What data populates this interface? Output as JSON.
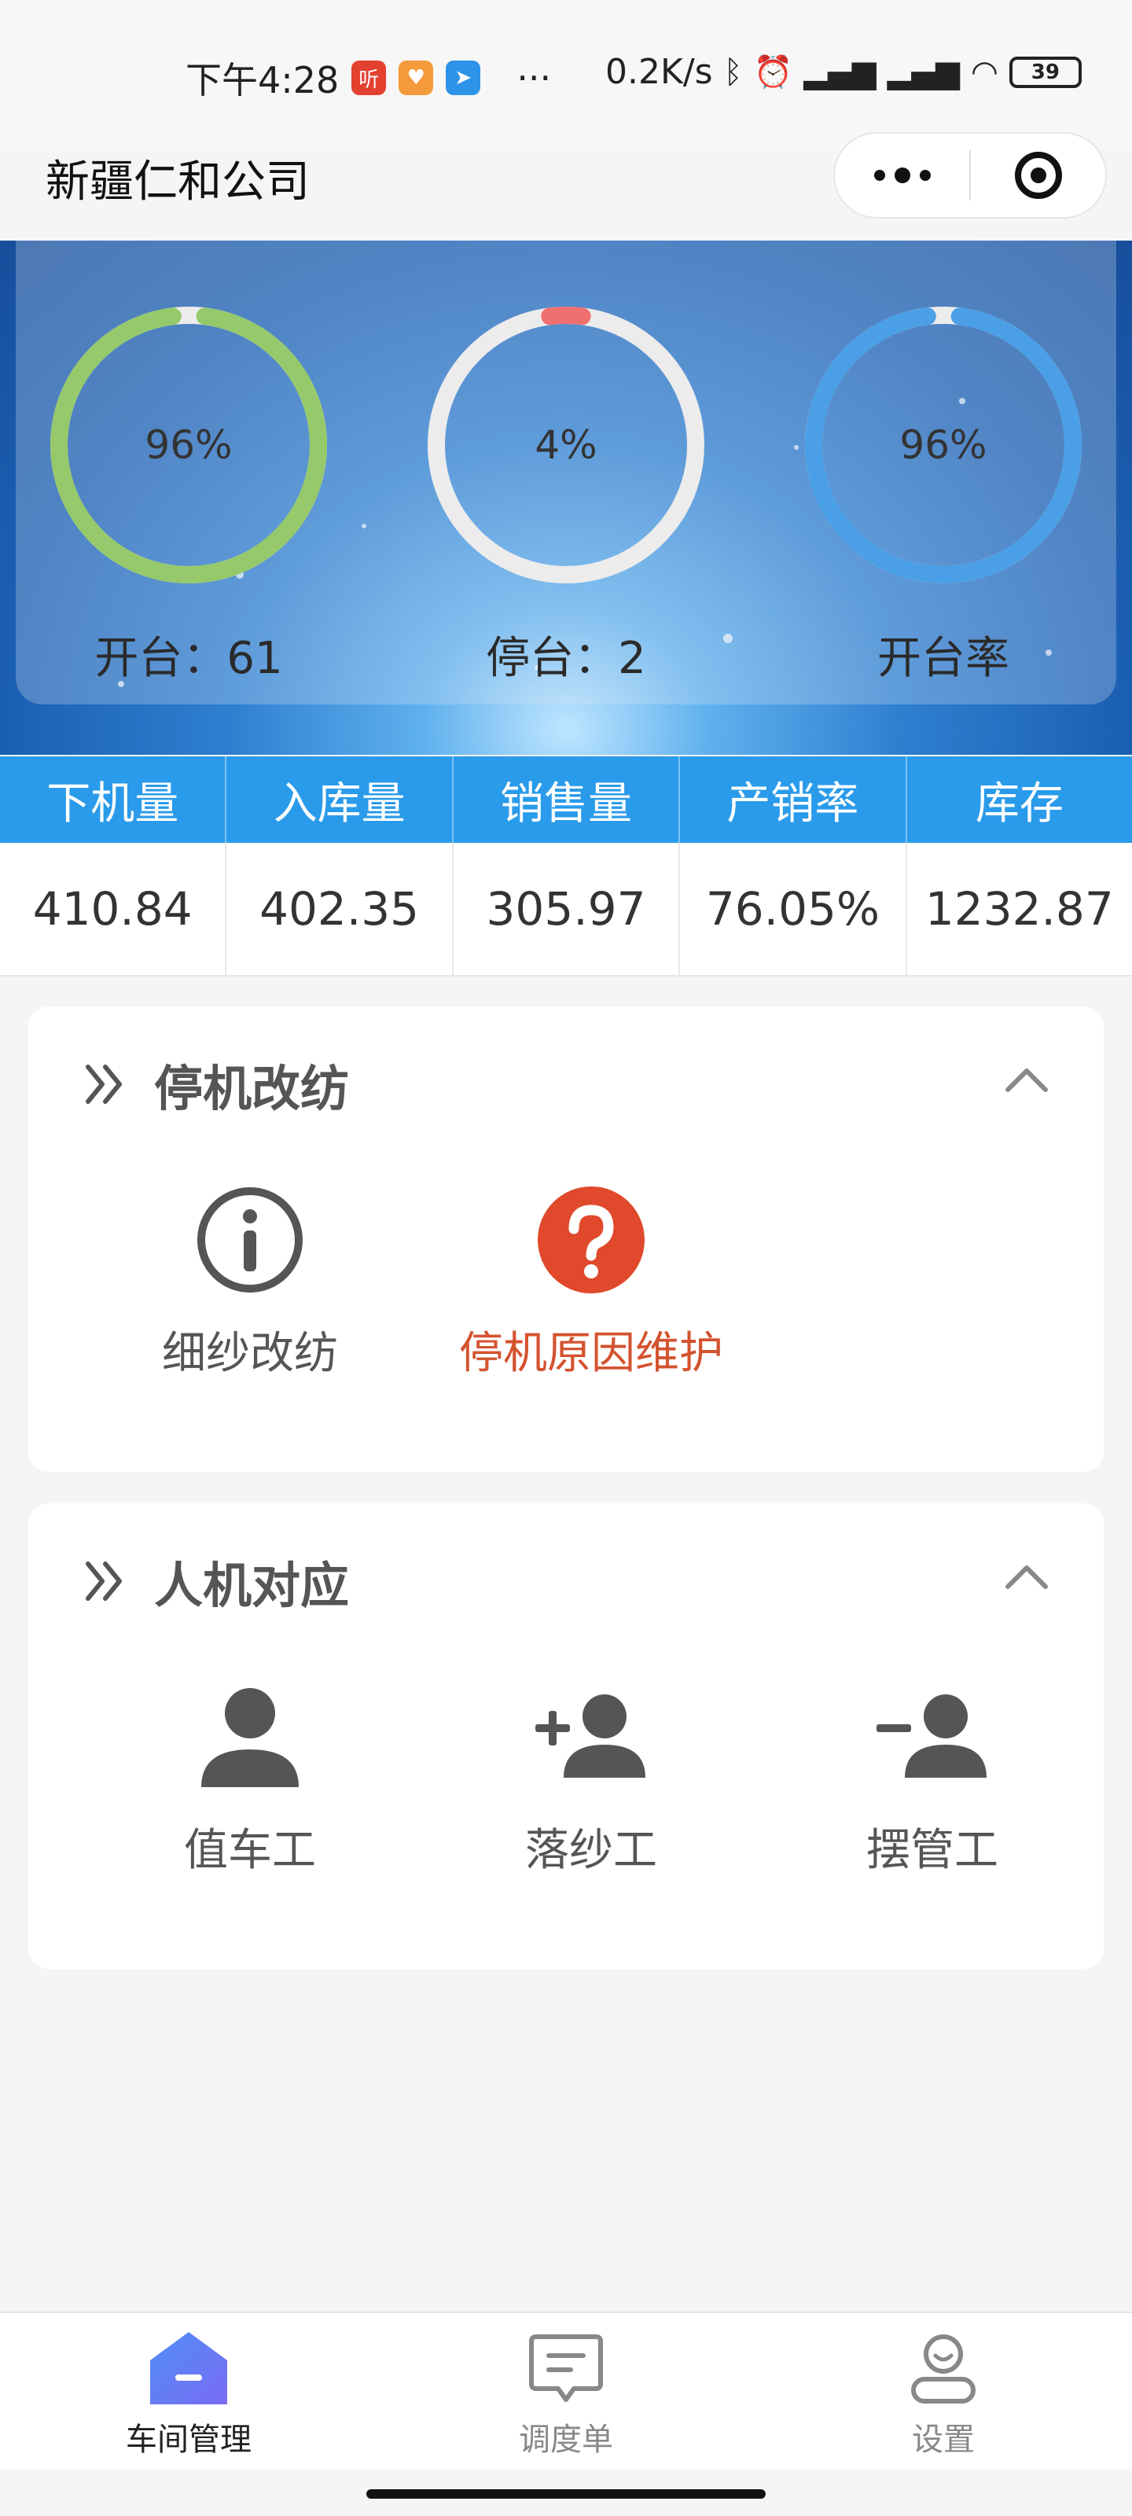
{
  "status_bar": {
    "time": "下午4:28",
    "app_icon_1": "听",
    "more": "···",
    "network_speed": "0.2K/s",
    "battery": "39"
  },
  "header": {
    "title": "新疆仁和公司"
  },
  "hero": {
    "gauges": [
      {
        "percent_text": "96%",
        "value": 96,
        "color": "#95c96b",
        "label": "开台：61"
      },
      {
        "percent_text": "4%",
        "value": 4,
        "color": "#f07070",
        "label": "停台：2"
      },
      {
        "percent_text": "96%",
        "value": 96,
        "color": "#4a9fe6",
        "label": "开台率"
      }
    ]
  },
  "stats": {
    "headers": [
      "下机量",
      "入库量",
      "销售量",
      "产销率",
      "库存"
    ],
    "values": [
      "410.84",
      "402.35",
      "305.97",
      "76.05%",
      "1232.87"
    ]
  },
  "section_stop": {
    "title": "停机改纺",
    "items": [
      {
        "label": "细纱改纺",
        "icon": "info-icon"
      },
      {
        "label": "停机原因维护",
        "icon": "question-icon",
        "color": "#d4532f"
      }
    ]
  },
  "section_people": {
    "title": "人机对应",
    "items": [
      {
        "label": "值车工",
        "icon": "person-icon"
      },
      {
        "label": "落纱工",
        "icon": "person-add-icon"
      },
      {
        "label": "摆管工",
        "icon": "person-remove-icon"
      }
    ]
  },
  "tabbar": {
    "tabs": [
      {
        "label": "车间管理",
        "icon": "workshop-icon",
        "active": true
      },
      {
        "label": "调度单",
        "icon": "dispatch-icon",
        "active": false
      },
      {
        "label": "设置",
        "icon": "settings-user-icon",
        "active": false
      }
    ],
    "active_color": "#6a7df5"
  }
}
